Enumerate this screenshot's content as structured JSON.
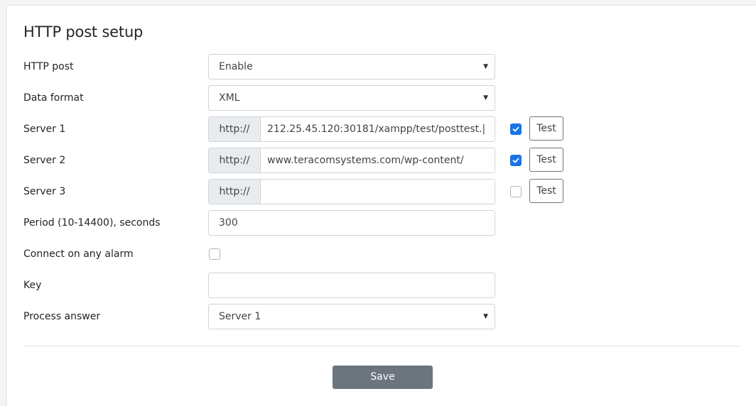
{
  "page": {
    "title": "HTTP post setup"
  },
  "fields": {
    "http_post": {
      "label": "HTTP post",
      "value": "Enable"
    },
    "data_format": {
      "label": "Data format",
      "value": "XML"
    },
    "server1": {
      "label": "Server 1",
      "prefix": "http://",
      "value": "212.25.45.120:30181/xampp/test/posttest.|",
      "checked": true,
      "test_label": "Test"
    },
    "server2": {
      "label": "Server 2",
      "prefix": "http://",
      "value": "www.teracomsystems.com/wp-content/",
      "checked": true,
      "test_label": "Test"
    },
    "server3": {
      "label": "Server 3",
      "prefix": "http://",
      "value": "",
      "checked": false,
      "test_label": "Test"
    },
    "period": {
      "label": "Period (10-14400), seconds",
      "value": "300"
    },
    "connect_alarm": {
      "label": "Connect on any alarm",
      "checked": false
    },
    "key": {
      "label": "Key",
      "value": ""
    },
    "process_answer": {
      "label": "Process answer",
      "value": "Server 1"
    }
  },
  "actions": {
    "save_label": "Save"
  },
  "colors": {
    "accent": "#1a73e8",
    "save_bg": "#6c757d"
  },
  "icons": {
    "caret": "chevron-down-icon",
    "check": "checkmark-icon"
  }
}
